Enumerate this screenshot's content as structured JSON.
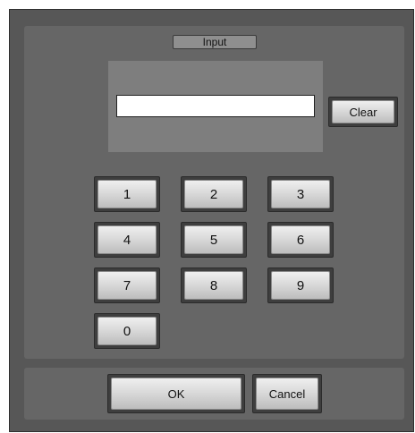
{
  "dialog": {
    "title": "Input",
    "input_value": "",
    "clear_label": "Clear",
    "keypad": {
      "row1": [
        "1",
        "2",
        "3"
      ],
      "row2": [
        "4",
        "5",
        "6"
      ],
      "row3": [
        "7",
        "8",
        "9"
      ],
      "row4": [
        "0"
      ]
    },
    "ok_label": "OK",
    "cancel_label": "Cancel"
  }
}
